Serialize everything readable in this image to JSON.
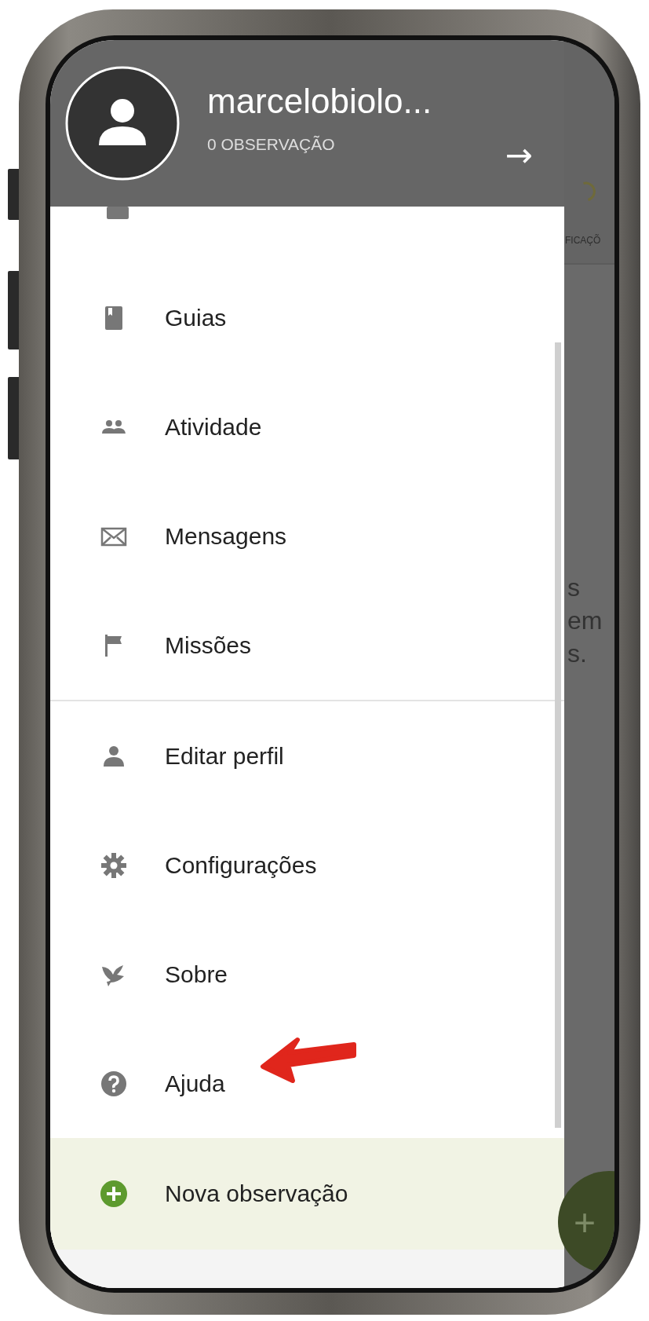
{
  "drawer": {
    "header": {
      "name": "marcelobiolo...",
      "subtitle": "0 OBSERVAÇÃO",
      "arrow": "→"
    },
    "sections": [
      {
        "items": [
          {
            "label": "Guias",
            "kind": "book"
          },
          {
            "label": "Atividade",
            "kind": "people"
          },
          {
            "label": "Mensagens",
            "kind": "mail"
          },
          {
            "label": "Missões",
            "kind": "flag"
          }
        ]
      },
      {
        "items": [
          {
            "label": "Editar perfil",
            "kind": "person"
          },
          {
            "label": "Configurações",
            "kind": "gear"
          },
          {
            "label": "Sobre",
            "kind": "bird"
          },
          {
            "label": "Ajuda",
            "kind": "help",
            "annotated": true
          }
        ]
      }
    ],
    "action": {
      "label": "Nova observação",
      "kind": "plus"
    }
  },
  "background": {
    "tab_label": "FICAÇÕ",
    "text_fragments": [
      "s",
      "em",
      "s."
    ],
    "fab": "+"
  }
}
